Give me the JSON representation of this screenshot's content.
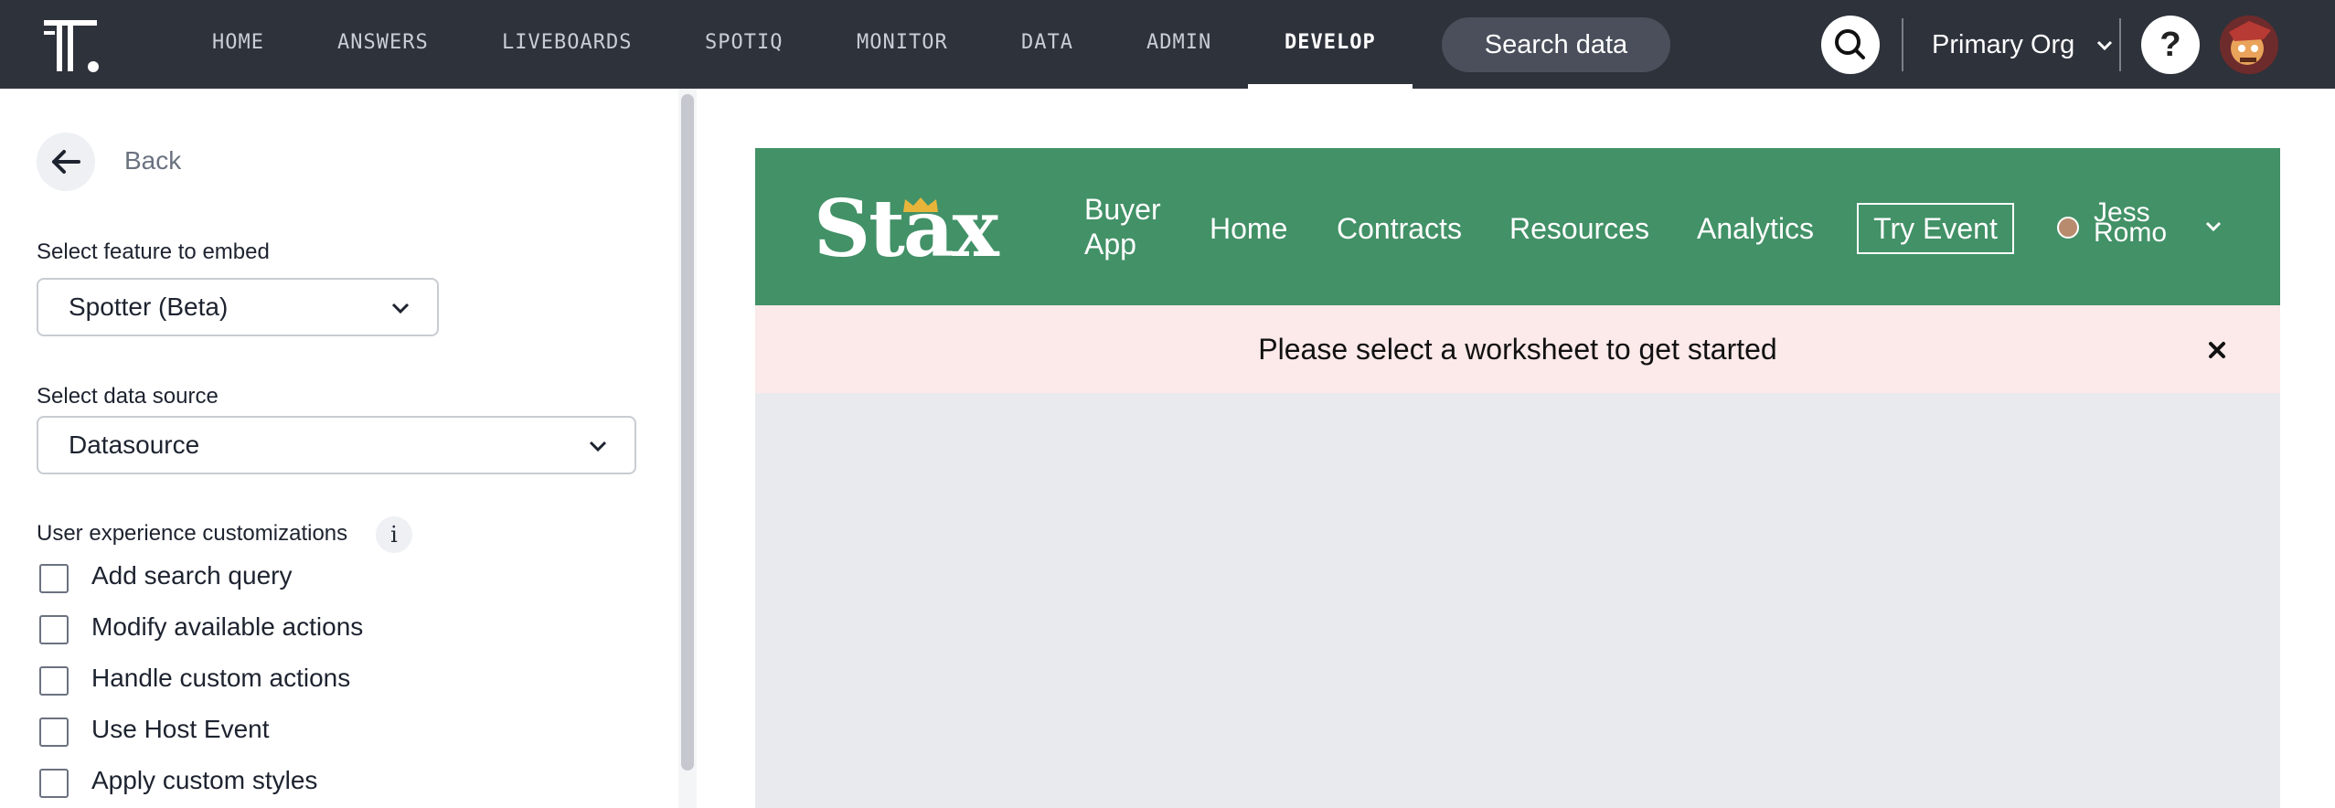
{
  "topnav": {
    "items": [
      "HOME",
      "ANSWERS",
      "LIVEBOARDS",
      "SPOTIQ",
      "MONITOR",
      "DATA",
      "ADMIN",
      "DEVELOP"
    ],
    "active": "DEVELOP",
    "search_label": "Search data",
    "org_name": "Primary Org",
    "help_label": "?"
  },
  "left": {
    "back_label": "Back",
    "feature_label": "Select feature to embed",
    "feature_value": "Spotter (Beta)",
    "datasource_label": "Select data source",
    "datasource_value": "Datasource",
    "ux_label": "User experience customizations",
    "info_glyph": "i",
    "checkboxes": [
      {
        "label": "Add search query",
        "checked": false
      },
      {
        "label": "Modify available actions",
        "checked": false
      },
      {
        "label": "Handle custom actions",
        "checked": false
      },
      {
        "label": "Use Host Event",
        "checked": false
      },
      {
        "label": "Apply custom styles",
        "checked": false
      }
    ]
  },
  "embed": {
    "brand": "Stax",
    "brand_color": "#429167",
    "nav": [
      "Buyer App",
      "Home",
      "Contracts",
      "Resources",
      "Analytics"
    ],
    "try_event": "Try Event",
    "user_name": "Jess Romo",
    "alert_text": "Please select a worksheet to get started",
    "alert_color": "#fce9e9"
  },
  "colors": {
    "topbar_bg": "#2e323b",
    "crown": "#e8b53a"
  }
}
